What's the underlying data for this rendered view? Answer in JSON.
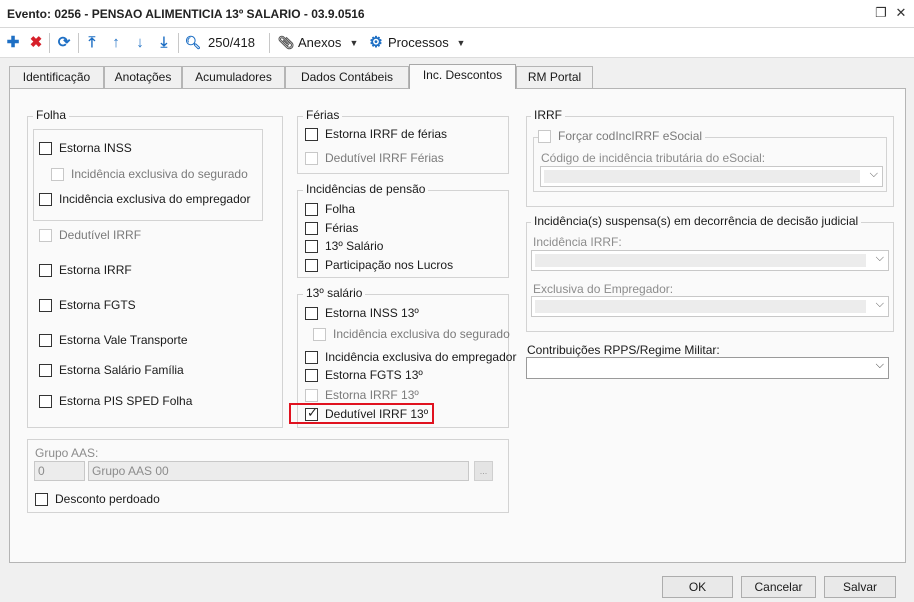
{
  "window": {
    "title": "Evento: 0256 - PENSAO ALIMENTICIA 13º SALARIO - 03.9.0516",
    "restore_glyph": "❐",
    "close_glyph": "✕"
  },
  "toolbar": {
    "add_glyph": "✚",
    "delete_glyph": "✖",
    "refresh_glyph": "⟳",
    "first_glyph": "⤒",
    "up_glyph": "↑",
    "down_glyph": "↓",
    "last_glyph": "⤓",
    "search_glyph": "🔍︎",
    "record_counter": "250/418",
    "attach_glyph": "📎︎",
    "anexos_label": "Anexos",
    "gear_glyph": "⚙",
    "processos_label": "Processos",
    "caret_glyph": "▼"
  },
  "tabs": [
    {
      "label": "Identificação"
    },
    {
      "label": "Anotações"
    },
    {
      "label": "Acumuladores"
    },
    {
      "label": "Dados Contábeis"
    },
    {
      "label": "Inc. Descontos"
    },
    {
      "label": "RM Portal"
    }
  ],
  "folha": {
    "title": "Folha",
    "estorna_inss": "Estorna INSS",
    "inc_excl_segurado": "Incidência exclusiva do segurado",
    "inc_excl_empregador": "Incidência exclusiva do empregador",
    "dedutivel_irrf": "Dedutível IRRF",
    "estorna_irrf": "Estorna IRRF",
    "estorna_fgts": "Estorna FGTS",
    "estorna_vale": "Estorna Vale Transporte",
    "estorna_salario_familia": "Estorna Salário Família",
    "estorna_pis": "Estorna PIS SPED Folha"
  },
  "ferias": {
    "title": "Férias",
    "estorna_irrf_ferias": "Estorna IRRF de férias",
    "dedutivel_irrf_ferias": "Dedutível IRRF Férias"
  },
  "pensao": {
    "title": "Incidências de pensão",
    "folha": "Folha",
    "ferias": "Férias",
    "decimo": "13º Salário",
    "plr": "Participação nos Lucros"
  },
  "decimo": {
    "title": "13º salário",
    "estorna_inss": "Estorna INSS 13º",
    "inc_excl_segurado": "Incidência exclusiva do segurado",
    "inc_excl_empregador": "Incidência exclusiva do empregador",
    "estorna_fgts": "Estorna FGTS 13º",
    "estorna_irrf": "Estorna IRRF 13º",
    "dedutivel_irrf": "Dedutível IRRF 13º",
    "dedutivel_checked": true
  },
  "grupo_aas": {
    "label": "Grupo AAS:",
    "code": "0",
    "name": "Grupo AAS 00",
    "lookup": "...",
    "desconto_perdoado": "Desconto perdoado"
  },
  "irrf": {
    "title": "IRRF",
    "forcar": "Forçar codIncIRRF eSocial",
    "codigo_label": "Código de incidência tributária do eSocial:"
  },
  "suspensa": {
    "title": "Incidência(s) suspensa(s) em decorrência de decisão judicial",
    "inc_irrf_label": "Incidência IRRF:",
    "excl_empregador_label": "Exclusiva do Empregador:"
  },
  "rpps": {
    "label": "Contribuições RPPS/Regime Militar:",
    "value": ""
  },
  "dropdown_glyph": "⌵",
  "check_glyph": "✓",
  "buttons": {
    "ok": "OK",
    "cancel": "Cancelar",
    "save": "Salvar"
  }
}
